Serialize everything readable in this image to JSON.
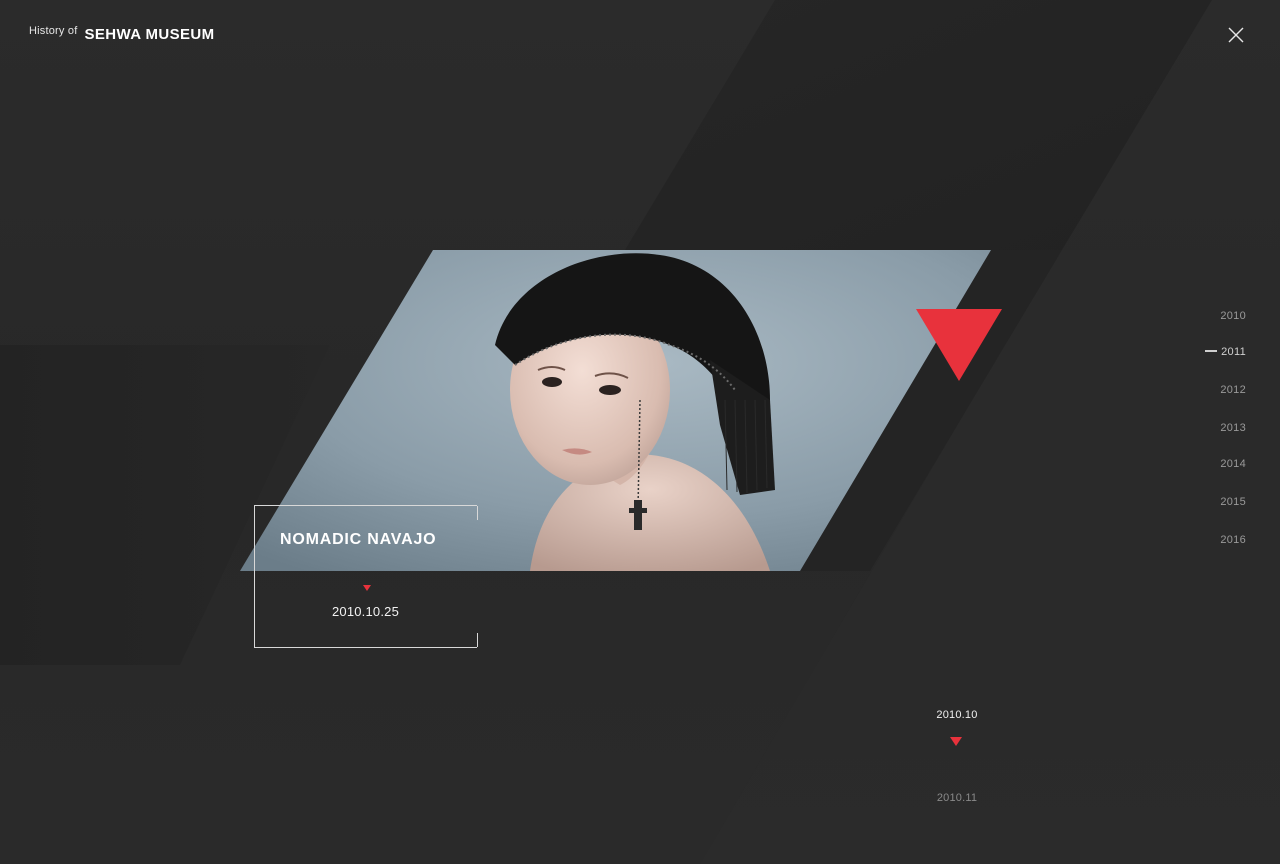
{
  "header": {
    "pre_title": "History of",
    "brand": "SEHWA MUSEUM"
  },
  "close_icon": "close-icon",
  "featured": {
    "title": "NOMADIC NAVAJO",
    "date": "2010.10.25"
  },
  "years": [
    {
      "label": "2010",
      "active": false
    },
    {
      "label": "2011",
      "active": true
    },
    {
      "label": "2012",
      "active": false
    },
    {
      "label": "2013",
      "active": false
    },
    {
      "label": "2014",
      "active": false
    },
    {
      "label": "2015",
      "active": false
    },
    {
      "label": "2016",
      "active": false
    }
  ],
  "months": {
    "current": "2010.10",
    "next": "2010.11"
  },
  "colors": {
    "accent": "#e8323c",
    "background": "#2a2a2a"
  }
}
